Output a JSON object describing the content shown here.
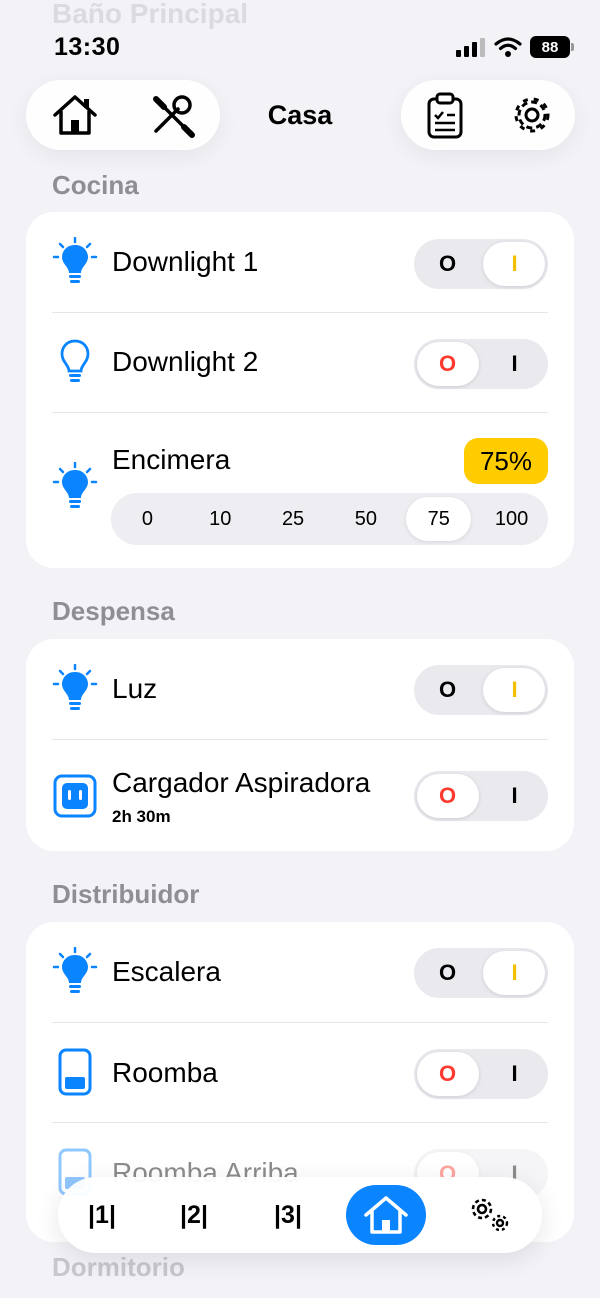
{
  "status": {
    "time": "13:30",
    "battery": "88"
  },
  "background": {
    "previous_section": "Baño Principal",
    "next_section": "Dormitorio"
  },
  "header": {
    "title": "Casa"
  },
  "sections": [
    {
      "title": "Cocina",
      "items": [
        {
          "label": "Downlight 1",
          "icon": "bulb-lit-icon",
          "type": "toggle",
          "state": "on",
          "off_label": "O",
          "on_label": "I"
        },
        {
          "label": "Downlight 2",
          "icon": "bulb-outline-icon",
          "type": "toggle",
          "state": "off",
          "off_label": "O",
          "on_label": "I"
        },
        {
          "label": "Encimera",
          "icon": "bulb-lit-icon",
          "type": "dimmer",
          "value": "75%",
          "options": [
            "0",
            "10",
            "25",
            "50",
            "75",
            "100"
          ],
          "selected": "75"
        }
      ]
    },
    {
      "title": "Despensa",
      "items": [
        {
          "label": "Luz",
          "icon": "bulb-lit-icon",
          "type": "toggle",
          "state": "on",
          "off_label": "O",
          "on_label": "I"
        },
        {
          "label": "Cargador Aspiradora",
          "sublabel": "2h 30m",
          "icon": "outlet-icon",
          "type": "toggle",
          "state": "off",
          "off_label": "O",
          "on_label": "I"
        }
      ]
    },
    {
      "title": "Distribuidor",
      "items": [
        {
          "label": "Escalera",
          "icon": "bulb-lit-icon",
          "type": "toggle",
          "state": "on",
          "off_label": "O",
          "on_label": "I"
        },
        {
          "label": "Roomba",
          "icon": "battery-device-icon",
          "type": "toggle",
          "state": "off",
          "off_label": "O",
          "on_label": "I"
        },
        {
          "label": "Roomba Arriba",
          "icon": "battery-device-icon",
          "type": "toggle",
          "state": "off",
          "off_label": "O",
          "on_label": "I"
        }
      ]
    }
  ],
  "tabbar": {
    "tab1": "|1|",
    "tab2": "|2|",
    "tab3": "|3|"
  },
  "colors": {
    "accent": "#0a84ff",
    "on": "#f3c000",
    "off": "#ff3b30",
    "badge": "#ffcc00"
  }
}
